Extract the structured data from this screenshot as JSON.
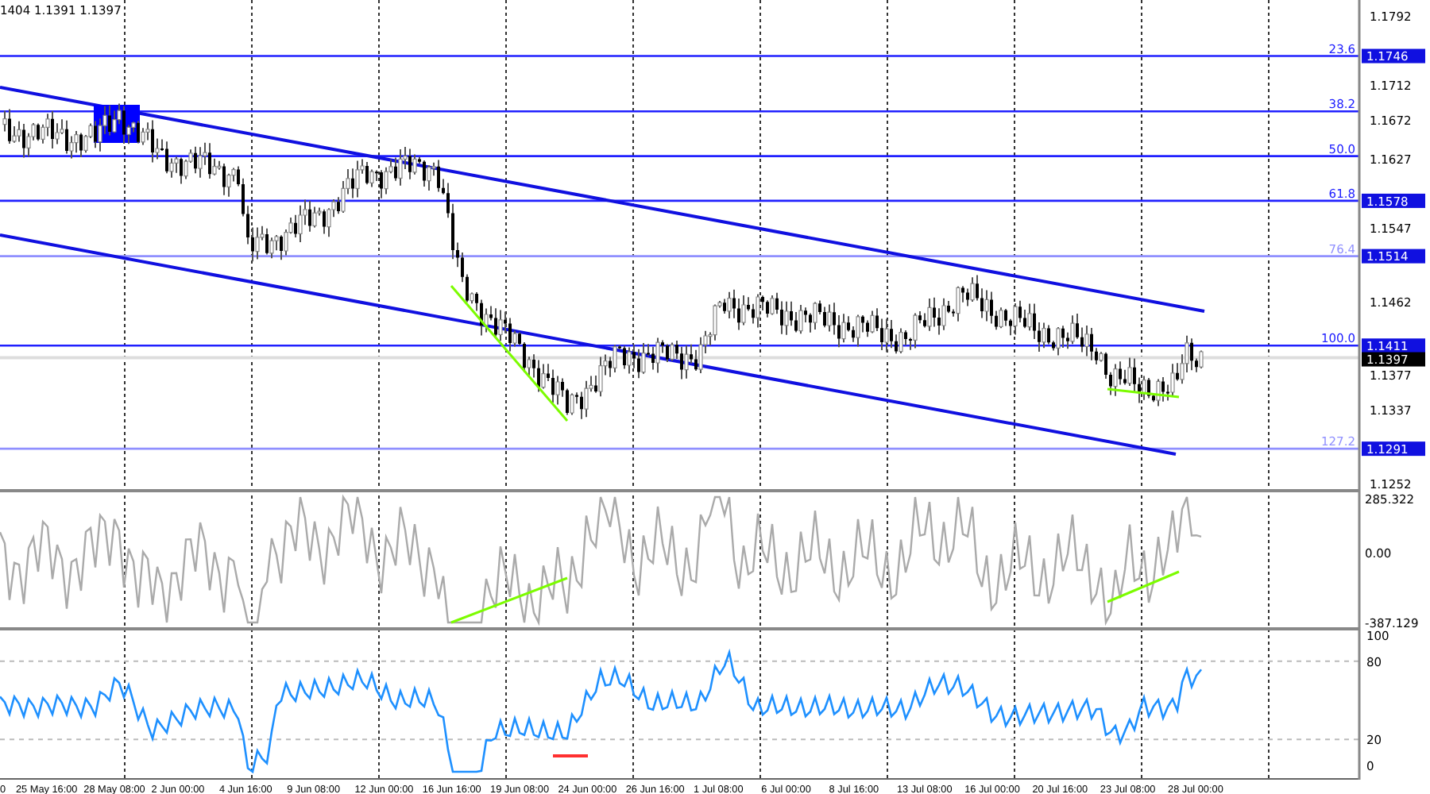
{
  "header": {
    "quote": "1404 1.1391 1.1397"
  },
  "fib_levels": [
    {
      "label": "23.6",
      "price_tag": "1.1746",
      "color": "#2020ff"
    },
    {
      "label": "38.2",
      "color": "#2020ff"
    },
    {
      "label": "50.0",
      "color": "#2020ff"
    },
    {
      "label": "61.8",
      "price_tag": "1.1578",
      "color": "#2020ff"
    },
    {
      "label": "76.4",
      "price_tag": "1.1514",
      "color": "#9090ff"
    },
    {
      "label": "100.0",
      "price_tag": "1.1411",
      "color": "#2020ff"
    },
    {
      "label": "127.2",
      "price_tag": "1.1291",
      "color": "#9090ff"
    }
  ],
  "price_axis": [
    "1.1792",
    "1.1712",
    "1.1672",
    "1.1627",
    "1.1547",
    "1.1462",
    "1.1377",
    "1.1337",
    "1.1252"
  ],
  "current_price": "1.1397",
  "cci_axis": [
    "285.322",
    "0.00",
    "-387.129"
  ],
  "rsi_axis": [
    "100",
    "80",
    "20",
    "0"
  ],
  "time_axis": [
    "0",
    "25 May 16:00",
    "28 May 08:00",
    "2 Jun 00:00",
    "4 Jun 16:00",
    "9 Jun 08:00",
    "12 Jun 00:00",
    "16 Jun 16:00",
    "19 Jun 08:00",
    "24 Jun 00:00",
    "26 Jun 16:00",
    "1 Jul 08:00",
    "6 Jul 00:00",
    "8 Jul 16:00",
    "13 Jul 08:00",
    "16 Jul 00:00",
    "20 Jul 16:00",
    "23 Jul 08:00",
    "28 Jul 00:00"
  ]
}
